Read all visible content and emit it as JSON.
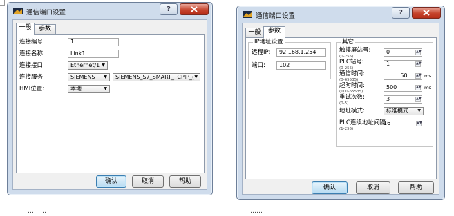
{
  "dialog_title": "通信端口设置",
  "tabs": {
    "general": "一般",
    "params": "参数"
  },
  "left": {
    "fields": {
      "conn_no_label": "连接编号:",
      "conn_no_value": "1",
      "conn_name_label": "连接名称:",
      "conn_name_value": "Link1",
      "conn_port_label": "连接接口:",
      "conn_port_value": "Ethernet/1",
      "conn_service_label": "连接服务:",
      "conn_service_value": "SIEMENS",
      "conn_service_driver": "SIEMENS_S7_SMART_TCPIP_(",
      "hmi_pos_label": "HMI位置:",
      "hmi_pos_value": "本地"
    }
  },
  "right": {
    "ip_group": {
      "legend": "IP地址设置",
      "remote_ip_label": "远程IP:",
      "remote_ip_value": "92.168.1.254",
      "port_label": "端口:",
      "port_value": "102"
    },
    "other_group": {
      "legend": "其它",
      "touch_station_label": "触摸屏站号:",
      "touch_station_range": "(0-255)",
      "touch_station_value": "0",
      "plc_station_label": "PLC站号:",
      "plc_station_range": "(0-255)",
      "plc_station_value": "1",
      "comm_time_label": "通信时间:",
      "comm_time_range": "(0-65535)",
      "comm_time_value": "50",
      "comm_time_unit": "ms",
      "timeout_label": "超时时间:",
      "timeout_range": "(100-65535)",
      "timeout_value": "500",
      "timeout_unit": "ms",
      "retry_label": "重试次数:",
      "retry_range": "(0-5)",
      "retry_value": "3",
      "addr_mode_label": "地址模式:",
      "addr_mode_value": "标准模式",
      "plc_interval_label": "PLC连续地址间隔",
      "plc_interval_range": "(1-255)",
      "plc_interval_value": "16"
    }
  },
  "buttons": {
    "ok": "确认",
    "cancel": "取消",
    "help": "帮助"
  },
  "help_glyph": "?",
  "spin_glyph": "▲▼",
  "arrow_glyph": "▼",
  "captions": {
    "left": "………",
    "right": "……"
  },
  "colors": {
    "title_bg": "#cfdcec",
    "close_red": "#c6452f",
    "default_btn": "#b7dbf2"
  }
}
